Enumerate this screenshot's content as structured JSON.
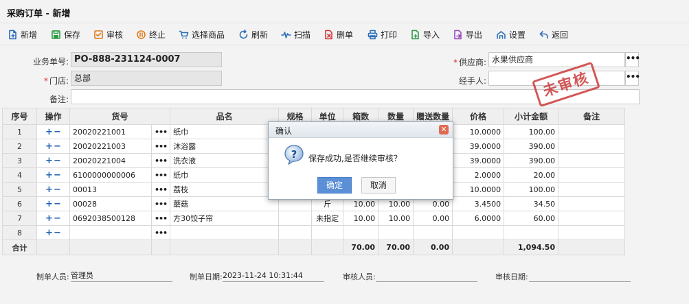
{
  "window": {
    "title": "采购订单 - 新增"
  },
  "toolbar": [
    {
      "label": "新增",
      "icon": "new-doc-icon",
      "color": "#2a6ebb"
    },
    {
      "label": "保存",
      "icon": "save-icon",
      "color": "#2e9b46"
    },
    {
      "label": "审核",
      "icon": "audit-check-icon",
      "color": "#e07b18"
    },
    {
      "label": "终止",
      "icon": "stop-icon",
      "color": "#e07b18"
    },
    {
      "label": "选择商品",
      "icon": "cart-icon",
      "color": "#2a6ebb"
    },
    {
      "label": "刷新",
      "icon": "refresh-icon",
      "color": "#2a6ebb"
    },
    {
      "label": "扫描",
      "icon": "scan-icon",
      "color": "#2a6ebb"
    },
    {
      "label": "删单",
      "icon": "delete-doc-icon",
      "color": "#d33a3a"
    },
    {
      "label": "打印",
      "icon": "print-icon",
      "color": "#2a6ebb"
    },
    {
      "label": "导入",
      "icon": "import-icon",
      "color": "#2e9b46"
    },
    {
      "label": "导出",
      "icon": "export-icon",
      "color": "#9a4bc0"
    },
    {
      "label": "设置",
      "icon": "settings-icon",
      "color": "#2a6ebb"
    },
    {
      "label": "返回",
      "icon": "back-icon",
      "color": "#2a6ebb"
    }
  ],
  "form": {
    "order_no_label": "业务单号:",
    "order_no": "PO-888-231124-0007",
    "store_label": "门店:",
    "store": "总部",
    "remark_label": "备注:",
    "remark": "",
    "supplier_label": "供应商:",
    "supplier": "水果供应商",
    "handler_label": "经手人:",
    "handler": "",
    "required_mark": "*"
  },
  "stamp": "未审核",
  "table": {
    "headers": [
      "序号",
      "操作",
      "货号",
      "品名",
      "规格",
      "单位",
      "箱数",
      "数量",
      "赠送数量",
      "价格",
      "小计金额",
      "备注"
    ],
    "rows": [
      {
        "no": "1",
        "code": "20020221001",
        "name": "纸巾",
        "spec": "",
        "unit": "",
        "boxes": "",
        "qty": "",
        "gift": "",
        "price": "10.0000",
        "subtotal": "100.00",
        "remark": ""
      },
      {
        "no": "2",
        "code": "20020221003",
        "name": "沐浴露",
        "spec": "",
        "unit": "",
        "boxes": "",
        "qty": "",
        "gift": "",
        "price": "39.0000",
        "subtotal": "390.00",
        "remark": ""
      },
      {
        "no": "3",
        "code": "20020221004",
        "name": "洗衣液",
        "spec": "",
        "unit": "",
        "boxes": "",
        "qty": "",
        "gift": "",
        "price": "39.0000",
        "subtotal": "390.00",
        "remark": ""
      },
      {
        "no": "4",
        "code": "6100000000006",
        "name": "纸巾",
        "spec": "",
        "unit": "",
        "boxes": "",
        "qty": "",
        "gift": "",
        "price": "2.0000",
        "subtotal": "20.00",
        "remark": ""
      },
      {
        "no": "5",
        "code": "00013",
        "name": "荔枝",
        "spec": "",
        "unit": "",
        "boxes": "",
        "qty": "",
        "gift": "",
        "price": "10.0000",
        "subtotal": "100.00",
        "remark": ""
      },
      {
        "no": "6",
        "code": "00028",
        "name": "蘑菇",
        "spec": "",
        "unit": "斤",
        "boxes": "10.00",
        "qty": "10.00",
        "gift": "0.00",
        "price": "3.4500",
        "subtotal": "34.50",
        "remark": ""
      },
      {
        "no": "7",
        "code": "0692038500128",
        "name": "方30饺子帘",
        "spec": "",
        "unit": "未指定",
        "boxes": "10.00",
        "qty": "10.00",
        "gift": "0.00",
        "price": "6.0000",
        "subtotal": "60.00",
        "remark": ""
      },
      {
        "no": "8",
        "code": "",
        "name": "",
        "spec": "",
        "unit": "",
        "boxes": "",
        "qty": "",
        "gift": "",
        "price": "",
        "subtotal": "",
        "remark": ""
      }
    ],
    "total": {
      "label": "合计",
      "boxes": "70.00",
      "qty": "70.00",
      "gift": "0.00",
      "subtotal": "1,094.50"
    }
  },
  "footer": {
    "creator_label": "制单人员:",
    "creator": "管理员",
    "created_label": "制单日期:",
    "created": "2023-11-24 10:31:44",
    "auditor_label": "审核人员:",
    "auditor": "",
    "audit_date_label": "审核日期:",
    "audit_date": ""
  },
  "dialog": {
    "title": "确认",
    "message": "保存成功,是否继续审核？",
    "ok": "确定",
    "cancel": "取消"
  }
}
